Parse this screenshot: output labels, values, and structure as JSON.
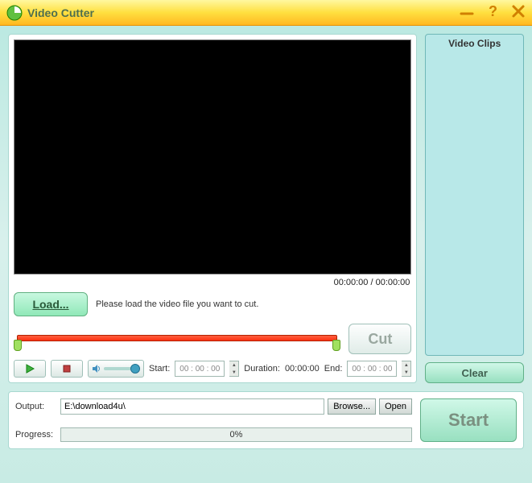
{
  "titlebar": {
    "title": "Video Cutter"
  },
  "preview": {
    "current_time": "00:00:00",
    "total_time": "00:00:00",
    "separator": " / "
  },
  "load": {
    "button_label": "Load...",
    "hint": "Please load the video file you want to cut."
  },
  "cut": {
    "button_label": "Cut"
  },
  "controls": {
    "start_label": "Start:",
    "start_value": "00 : 00 : 00",
    "duration_label": "Duration:",
    "duration_value": "00:00:00",
    "end_label": "End:",
    "end_value": "00 : 00 : 00"
  },
  "side": {
    "clips_title": "Video Clips",
    "clear_label": "Clear"
  },
  "output": {
    "label": "Output:",
    "path": "E:\\download4u\\",
    "browse_label": "Browse...",
    "open_label": "Open"
  },
  "progress": {
    "label": "Progress:",
    "text": "0%"
  },
  "start": {
    "label": "Start"
  }
}
